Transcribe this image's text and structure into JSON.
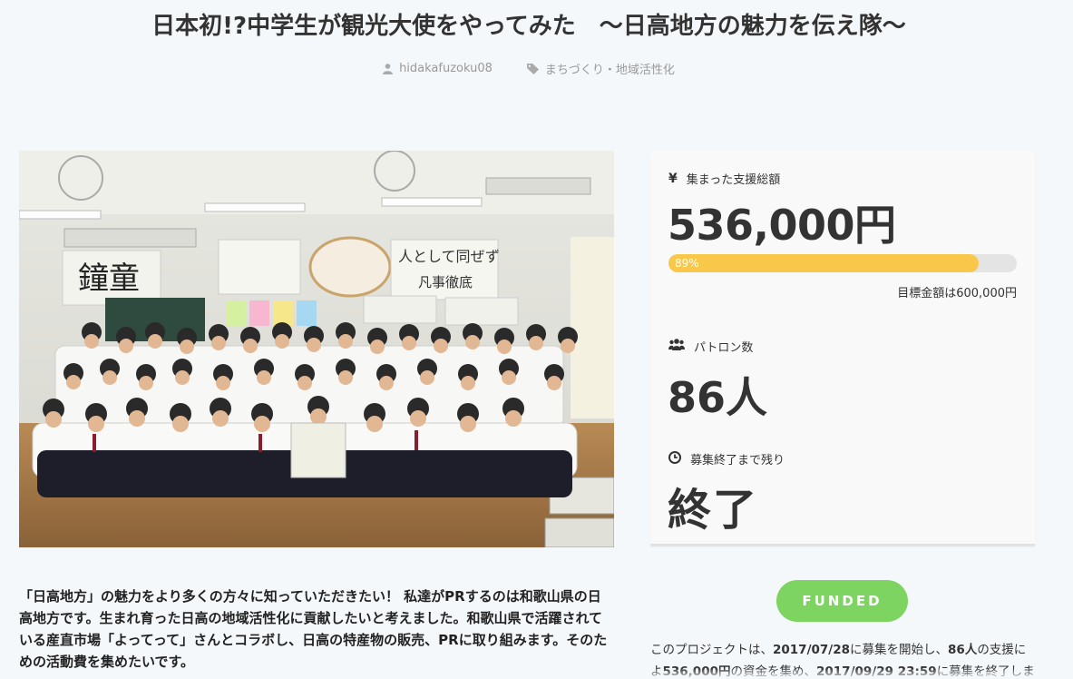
{
  "page": {
    "title": "日本初!?中学生が観光大使をやってみた　～日高地方の魅力を伝え隊～"
  },
  "meta": {
    "author": "hidakafuzoku08",
    "category": "まちづくり・地域活性化",
    "author_icon": "user-icon",
    "category_icon": "tag-icon"
  },
  "photo": {
    "blackboard_text": "鐘童",
    "poster_text_1": "人として同ぜず",
    "poster_text_2": "凡事徹底"
  },
  "summary": "「日高地方」の魅力をより多くの方々に知っていただきたい！ 私達がPRするのは和歌山県の日高地方です。生まれ育った日高の地域活性化に貢献したいと考えました。和歌山県で活躍されている産直市場「よってって」さんとコラボし、日高の特産物の販売、PRに取り組みます。そのための活動費を集めたいです。",
  "stats": {
    "amount_label": "集まった支援総額",
    "amount_icon": "yen-icon",
    "amount": "536,000円",
    "progress_percent": 89,
    "progress_text": "89%",
    "goal": "目標金額は600,000円",
    "patrons_label": "パトロン数",
    "patrons_icon": "users-icon",
    "patrons": "86人",
    "remaining_label": "募集終了まで残り",
    "remaining_icon": "clock-icon",
    "remaining": "終了"
  },
  "status_button": "FUNDED",
  "description": {
    "p1": "このプロジェクトは、",
    "start_date": "2017/07/28",
    "p2": "に募集を開始し、",
    "patrons": "86人",
    "p3": "の支援によ",
    "amount": "536,000円",
    "p4": "の資金を集め、",
    "end_date": "2017/09/29 23:59",
    "p5": "に募集を終了しまし"
  },
  "colors": {
    "background": "#f5f8fb",
    "progress_fill": "#f9c84a",
    "funded_button": "#7dd461"
  }
}
